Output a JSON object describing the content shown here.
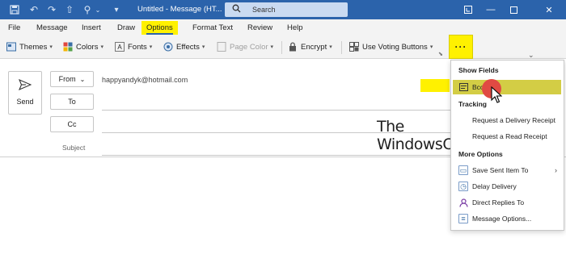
{
  "window": {
    "title": "Untitled - Message (HT...",
    "search_placeholder": "Search"
  },
  "menu": {
    "tabs": [
      "File",
      "Message",
      "Insert",
      "Draw",
      "Options",
      "Format Text",
      "Review",
      "Help"
    ],
    "active": "Options"
  },
  "ribbon": {
    "themes": "Themes",
    "colors": "Colors",
    "fonts": "Fonts",
    "effects": "Effects",
    "page_color": "Page Color",
    "encrypt": "Encrypt",
    "voting": "Use Voting Buttons",
    "more": "···"
  },
  "compose": {
    "send": "Send",
    "from_button": "From",
    "from_address": "happyandyk@hotmail.com",
    "to_button": "To",
    "cc_button": "Cc",
    "subject_label": "Subject"
  },
  "watermark": {
    "line1": "The",
    "line2": "WindowsClub"
  },
  "dropdown": {
    "show_fields_header": "Show Fields",
    "bcc": "Bcc",
    "tracking_header": "Tracking",
    "delivery_receipt": "Request a Delivery Receipt",
    "read_receipt": "Request a Read Receipt",
    "more_options_header": "More Options",
    "save_sent": "Save Sent Item To",
    "delay_delivery": "Delay Delivery",
    "direct_replies": "Direct Replies To",
    "message_options": "Message Options..."
  },
  "colors": {
    "titlebar": "#2b63ab",
    "highlight": "#fff100",
    "bcc_highlight": "#d3cd45",
    "pointer": "#e04a43"
  }
}
